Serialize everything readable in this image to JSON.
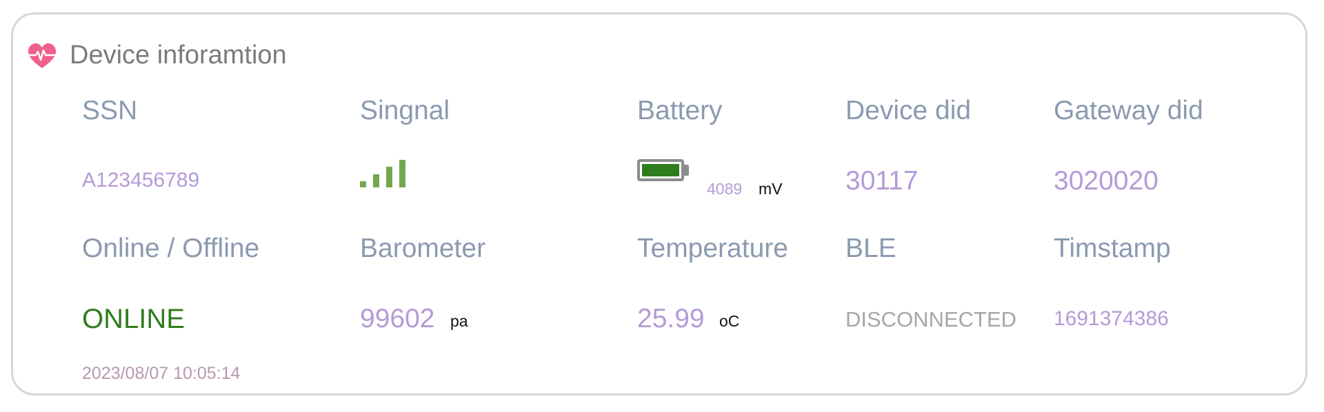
{
  "card": {
    "title": "Device inforamtion",
    "icon": "heart-pulse-icon"
  },
  "labels": {
    "ssn": "SSN",
    "signal": "Singnal",
    "battery": "Battery",
    "device_did": "Device did",
    "gateway_did": "Gateway did",
    "online_offline": "Online / Offline",
    "barometer": "Barometer",
    "temperature": "Temperature",
    "ble": "BLE",
    "timestamp": "Timstamp"
  },
  "values": {
    "ssn": "A123456789",
    "signal_bars": 4,
    "signal_bars_lit": 4,
    "battery_mv": "4089",
    "battery_unit": "mV",
    "battery_level": 1.0,
    "device_did": "30117",
    "gateway_did": "3020020",
    "status": "ONLINE",
    "status_time": "2023/08/07 10:05:14",
    "barometer": "99602",
    "barometer_unit": "pa",
    "temperature": "25.99",
    "temperature_unit": "oC",
    "ble": "DISCONNECTED",
    "timestamp": "1691374386"
  },
  "colors": {
    "label": "#8a9ab0",
    "value": "#b39bd6",
    "online": "#2f7d1e",
    "signal": "#74a850",
    "battery_fill": "#2e7c1e",
    "disconnected": "#a6a6a6",
    "heart": "#f0608a"
  }
}
